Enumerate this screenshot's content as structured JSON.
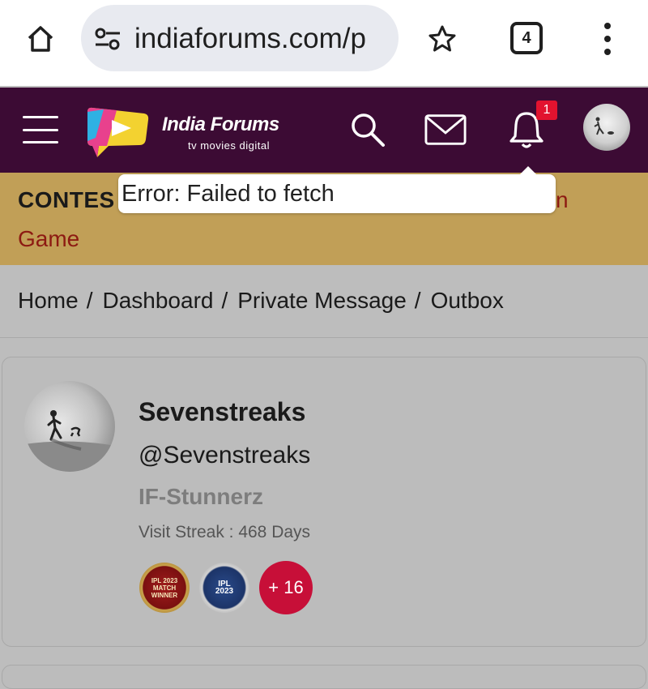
{
  "browser": {
    "url": "indiaforums.com/p",
    "tab_count": "4",
    "icons": [
      "home-icon",
      "site-settings-icon",
      "bookmark-star-icon",
      "tab-switcher-icon",
      "more-vert-icon"
    ]
  },
  "header": {
    "logo_title": "India Forums",
    "logo_tagline": "tv  movies  digital",
    "notification_count": "1",
    "colors": {
      "background": "#3c0b34",
      "badge": "#e2132f"
    },
    "icons": [
      "hamburger-icon",
      "search-icon",
      "mail-icon",
      "bell-icon"
    ]
  },
  "banner": {
    "line1_start": "CONTES",
    "line1_end": "n",
    "line2": "Game",
    "colors": {
      "background": "#c19f57",
      "accent_text": "#8d1a12"
    }
  },
  "tooltip": {
    "text": "Error: Failed to fetch"
  },
  "breadcrumb": {
    "items": [
      "Home",
      "Dashboard",
      "Private Message",
      "Outbox"
    ],
    "separator": "/"
  },
  "profile": {
    "display_name": "Sevenstreaks",
    "handle": "@Sevenstreaks",
    "rank": "IF-Stunnerz",
    "visit_streak": "Visit Streak : 468 Days",
    "badges": [
      {
        "icon": "award-badge-icon",
        "text": "IPL 2023 MATCH WINNER"
      },
      {
        "icon": "ipl-2023-badge-icon",
        "text": "IPL 2023"
      }
    ],
    "more_badges": "+ 16",
    "colors": {
      "more_badges": "#c70f38"
    }
  }
}
